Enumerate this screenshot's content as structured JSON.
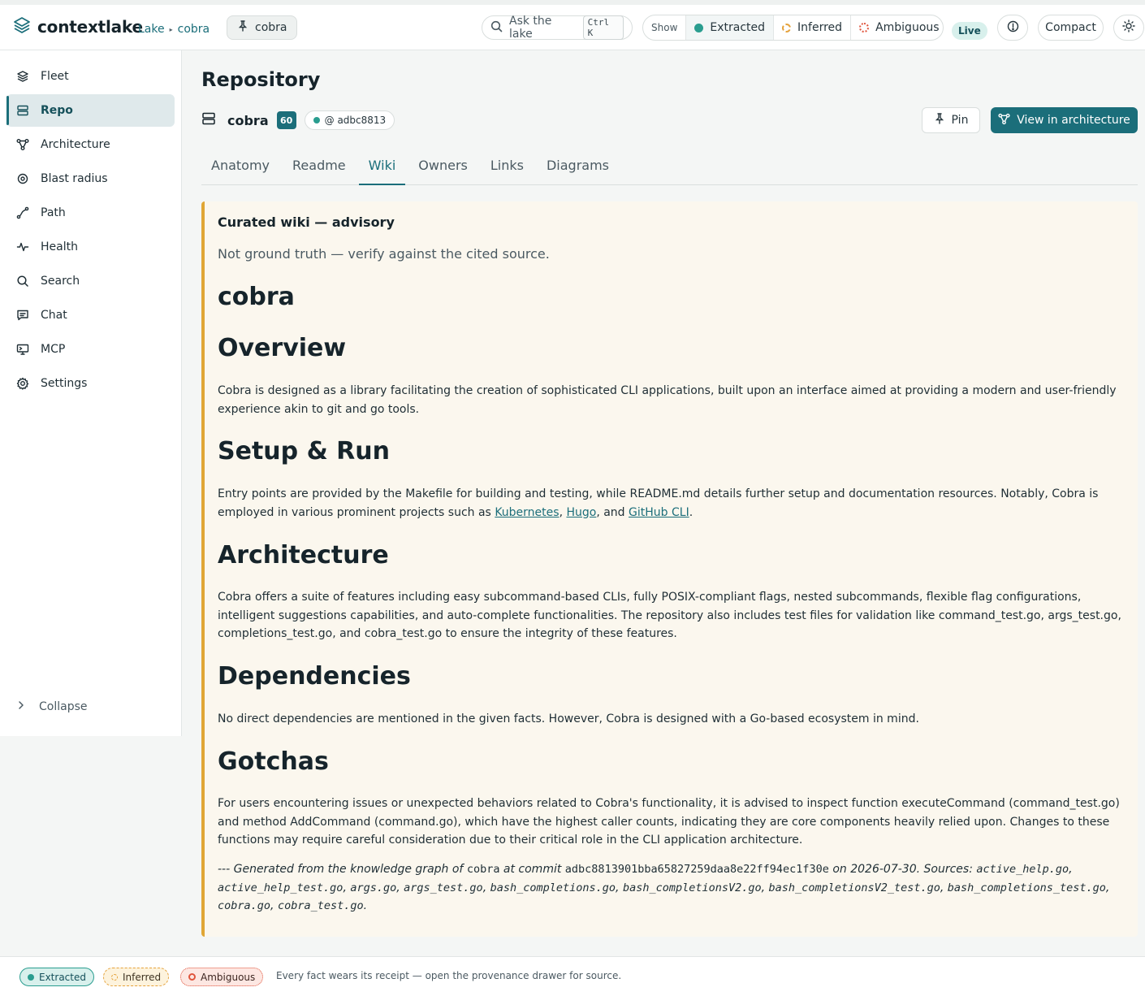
{
  "app": {
    "name": "contextlake"
  },
  "breadcrumb": [
    "Lake",
    "cobra"
  ],
  "pinned_chip": "cobra",
  "search": {
    "placeholder": "Ask the lake",
    "shortcut": "Ctrl K"
  },
  "show_filter": {
    "label": "Show",
    "items": [
      {
        "label": "Extracted",
        "color": "#2a9d8f"
      },
      {
        "label": "Inferred",
        "color": "#e5a23c"
      },
      {
        "label": "Ambiguous",
        "color": "#e0553d"
      }
    ]
  },
  "live_label": "Live",
  "compact_label": "Compact",
  "sidebar": {
    "items": [
      {
        "label": "Fleet",
        "icon": "layers-icon"
      },
      {
        "label": "Repo",
        "icon": "server-icon",
        "active": true
      },
      {
        "label": "Architecture",
        "icon": "graph-icon"
      },
      {
        "label": "Blast radius",
        "icon": "target-icon"
      },
      {
        "label": "Path",
        "icon": "route-icon"
      },
      {
        "label": "Health",
        "icon": "pulse-icon"
      },
      {
        "label": "Search",
        "icon": "search-icon"
      },
      {
        "label": "Chat",
        "icon": "chat-icon"
      },
      {
        "label": "MCP",
        "icon": "monitor-icon"
      },
      {
        "label": "Settings",
        "icon": "gear-icon"
      }
    ],
    "collapse_label": "Collapse"
  },
  "page": {
    "title": "Repository",
    "repo_name": "cobra",
    "score": "60",
    "commit_label": "@ adbc8813",
    "pin_label": "Pin",
    "view_arch_label": "View in architecture",
    "tabs": [
      "Anatomy",
      "Readme",
      "Wiki",
      "Owners",
      "Links",
      "Diagrams"
    ],
    "active_tab": "Wiki"
  },
  "wiki": {
    "advisory_title": "Curated wiki — advisory",
    "advisory_sub": "Not ground truth — verify against the cited source.",
    "title": "cobra",
    "overview_heading": "Overview",
    "overview_text": "Cobra is designed as a library facilitating the creation of sophisticated CLI applications, built upon an interface aimed at providing a modern and user-friendly experience akin to git and go tools.",
    "setup_heading": "Setup & Run",
    "setup_text_before": "Entry points are provided by the Makefile for building and testing, while README.md details further setup and documentation resources. Notably, Cobra is employed in various prominent projects such as ",
    "setup_links": [
      "Kubernetes",
      "Hugo",
      "GitHub CLI"
    ],
    "setup_sep1": ", ",
    "setup_sep2": ", and ",
    "setup_end": ".",
    "architecture_heading": "Architecture",
    "architecture_text": "Cobra offers a suite of features including easy subcommand-based CLIs, fully POSIX-compliant flags, nested subcommands, flexible flag configurations, intelligent suggestions capabilities, and auto-complete functionalities. The repository also includes test files for validation like command_test.go, args_test.go, completions_test.go, and cobra_test.go to ensure the integrity of these features.",
    "dependencies_heading": "Dependencies",
    "dependencies_text": "No direct dependencies are mentioned in the given facts. However, Cobra is designed with a Go-based ecosystem in mind.",
    "gotchas_heading": "Gotchas",
    "gotchas_text": "For users encountering issues or unexpected behaviors related to Cobra's functionality, it is advised to inspect function executeCommand (command_test.go) and method AddCommand (command.go), which have the highest caller counts, indicating they are core components heavily relied upon. Changes to these functions may require careful consideration due to their critical role in the CLI application architecture.",
    "footer": {
      "prefix": "--- Generated from the knowledge graph of ",
      "repo": "cobra",
      "at_commit": " at commit ",
      "commit": "adbc8813901bba65827259daa8e22ff94ec1f30e",
      "on_date": " on 2026-07-30. Sources: ",
      "sources": [
        "active_help.go",
        "active_help_test.go",
        "args.go",
        "args_test.go",
        "bash_completions.go",
        "bash_completionsV2.go",
        "bash_completionsV2_test.go",
        "bash_completions_test.go",
        "cobra.go",
        "cobra_test.go"
      ],
      "end": "."
    }
  },
  "bottom_bar": {
    "legend": [
      "Extracted",
      "Inferred",
      "Ambiguous"
    ],
    "text": "Every fact wears its receipt — open the provenance drawer for source."
  }
}
